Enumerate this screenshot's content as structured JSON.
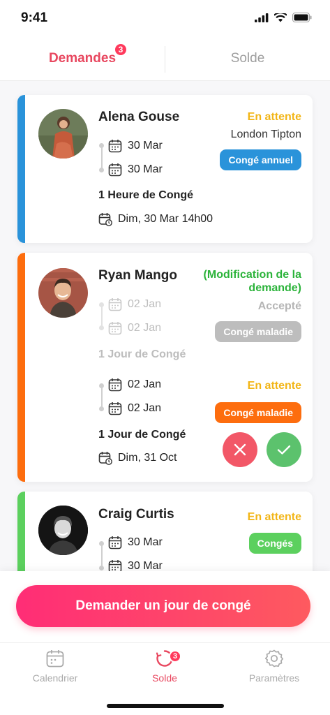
{
  "status_bar": {
    "time": "9:41"
  },
  "tabs": [
    {
      "label": "Demandes",
      "badge": "3",
      "active": true
    },
    {
      "label": "Solde",
      "active": false
    }
  ],
  "colors": {
    "accent": "#e8475f",
    "blue": "#2a93da",
    "orange": "#fd6d0e",
    "green": "#5cd05e",
    "pending": "#f2b516",
    "modified": "#2bb33a",
    "gray": "#bdbdbd"
  },
  "requests": [
    {
      "name": "Alena Gouse",
      "stripe_color": "#2a93da",
      "status": "En attente",
      "subtitle": "London Tipton",
      "type": "Congé annuel",
      "type_color": "#2a93da",
      "start": "30 Mar",
      "end": "30 Mar",
      "duration": "1 Heure de Congé",
      "when": "Dim, 30 Mar 14h00"
    },
    {
      "name": "Ryan Mango",
      "stripe_color": "#fd6d0e",
      "modified_label": "(Modification de la demande)",
      "previous": {
        "status": "Accepté",
        "type": "Congé maladie",
        "start": "02 Jan",
        "end": "02 Jan",
        "duration": "1 Jour de Congé"
      },
      "status": "En attente",
      "type": "Congé maladie",
      "type_color": "#fd6d0e",
      "start": "02 Jan",
      "end": "02 Jan",
      "duration": "1 Jour de Congé",
      "when": "Dim, 31 Oct",
      "actions": {
        "reject": "close-icon",
        "accept": "check-icon"
      }
    },
    {
      "name": "Craig Curtis",
      "stripe_color": "#5cd05e",
      "status": "En attente",
      "type": "Congés",
      "type_color": "#5cd05e",
      "start": "30 Mar",
      "end": "30 Mar"
    }
  ],
  "cta": {
    "label": "Demander un jour de congé"
  },
  "nav": [
    {
      "label": "Calendrier",
      "icon": "calendar-icon",
      "active": false
    },
    {
      "label": "Solde",
      "icon": "refresh-icon",
      "badge": "3",
      "active": true
    },
    {
      "label": "Paramètres",
      "icon": "gear-icon",
      "active": false
    }
  ]
}
